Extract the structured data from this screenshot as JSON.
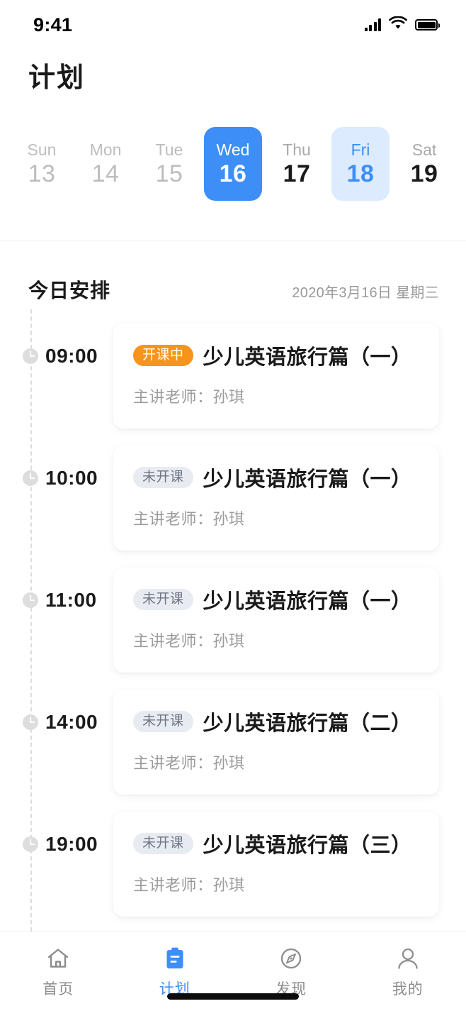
{
  "status_bar": {
    "time": "9:41",
    "signal_icon": "signal-bars-icon",
    "wifi_icon": "wifi-icon",
    "battery_icon": "battery-full-icon"
  },
  "header": {
    "title": "计划"
  },
  "week_selector": {
    "days": [
      {
        "name": "Sun",
        "num": "13",
        "state": "past"
      },
      {
        "name": "Mon",
        "num": "14",
        "state": "past"
      },
      {
        "name": "Tue",
        "num": "15",
        "state": "past"
      },
      {
        "name": "Wed",
        "num": "16",
        "state": "selected"
      },
      {
        "name": "Thu",
        "num": "17",
        "state": "normal"
      },
      {
        "name": "Fri",
        "num": "18",
        "state": "highlight"
      },
      {
        "name": "Sat",
        "num": "19",
        "state": "normal"
      }
    ]
  },
  "schedule": {
    "title": "今日安排",
    "date": "2020年3月16日 星期三",
    "items": [
      {
        "time": "09:00",
        "clock_icon": "clock-icon",
        "badge": "开课中",
        "badge_state": "live",
        "title": "少儿英语旅行篇（一）",
        "teacher": "主讲老师：孙琪"
      },
      {
        "time": "10:00",
        "clock_icon": "clock-icon",
        "badge": "未开课",
        "badge_state": "pending",
        "title": "少儿英语旅行篇（一）",
        "teacher": "主讲老师：孙琪"
      },
      {
        "time": "11:00",
        "clock_icon": "clock-icon",
        "badge": "未开课",
        "badge_state": "pending",
        "title": "少儿英语旅行篇（一）",
        "teacher": "主讲老师：孙琪"
      },
      {
        "time": "14:00",
        "clock_icon": "clock-icon",
        "badge": "未开课",
        "badge_state": "pending",
        "title": "少儿英语旅行篇（二）",
        "teacher": "主讲老师：孙琪"
      },
      {
        "time": "19:00",
        "clock_icon": "clock-icon",
        "badge": "未开课",
        "badge_state": "pending",
        "title": "少儿英语旅行篇（三）",
        "teacher": "主讲老师：孙琪"
      }
    ]
  },
  "tab_bar": {
    "items": [
      {
        "label": "首页",
        "icon": "home-icon",
        "active": false
      },
      {
        "label": "计划",
        "icon": "clipboard-icon",
        "active": true
      },
      {
        "label": "发现",
        "icon": "compass-icon",
        "active": false
      },
      {
        "label": "我的",
        "icon": "person-icon",
        "active": false
      }
    ]
  },
  "colors": {
    "accent_blue": "#3d8ef7",
    "accent_blue_soft": "#dcebfd",
    "badge_orange": "#f7941d",
    "badge_gray_bg": "#e8ebf1",
    "badge_gray_text": "#6d7483",
    "text_primary": "#1a1a1a",
    "text_muted": "#9a9a9a",
    "text_disabled": "#bdbdbd",
    "divider": "#eeeeee",
    "timeline_dash": "#dcdcdc"
  }
}
